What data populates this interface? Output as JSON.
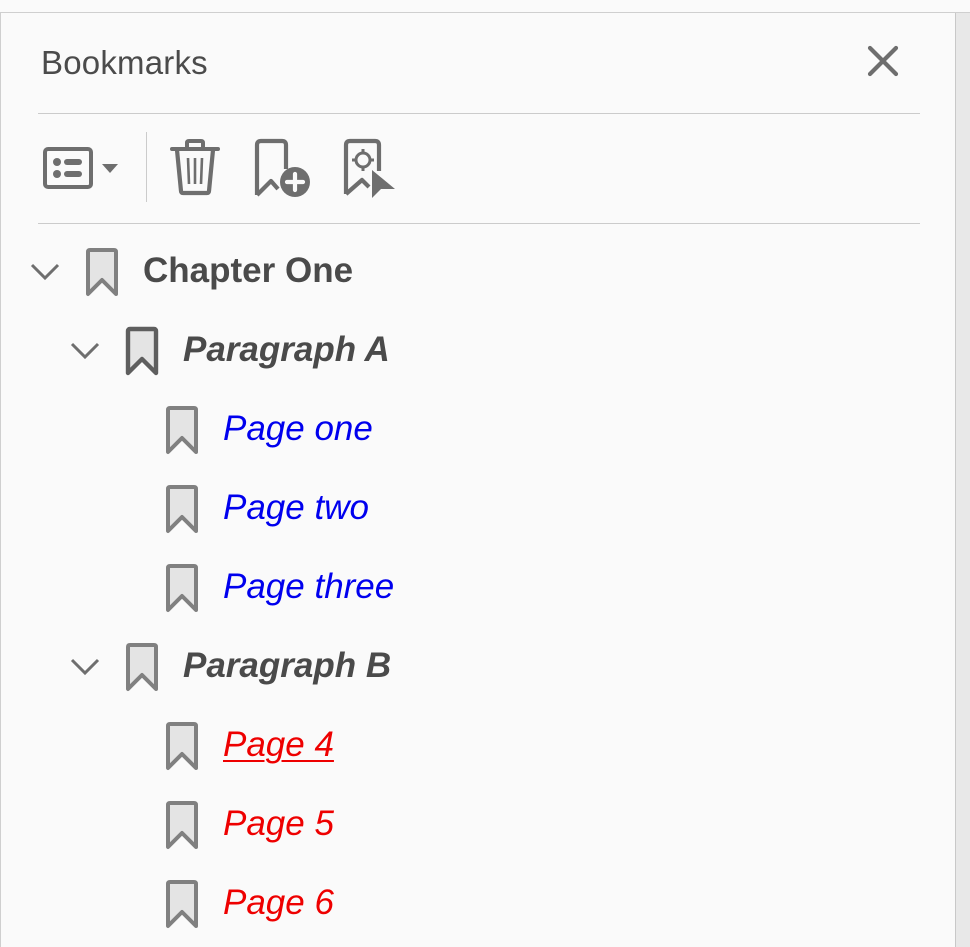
{
  "panel": {
    "title": "Bookmarks",
    "close_icon": "close-icon"
  },
  "toolbar": {
    "options_icon": "list-options-icon",
    "options_dropdown_icon": "caret-down-icon",
    "delete_icon": "trash-icon",
    "new_bookmark_icon": "bookmark-add-icon",
    "expand_current_icon": "bookmark-target-icon"
  },
  "colors": {
    "icon_gray": "#6e6e6e",
    "bookmark_stroke": "#808080",
    "bookmark_stroke_active": "#5e5e5e",
    "bookmark_fill": "#e4e4e4",
    "text_dark": "#4a4a4a",
    "link_blue": "#0000ee",
    "link_red": "#ee0000"
  },
  "tree": [
    {
      "label": "Chapter One",
      "level": 0,
      "expanded": true,
      "color": "#4a4a4a",
      "underlined": false,
      "active": false
    },
    {
      "label": "Paragraph A",
      "level": 1,
      "expanded": true,
      "color": "#4a4a4a",
      "underlined": false,
      "active": true
    },
    {
      "label": "Page one",
      "level": 2,
      "color": "#0000ee",
      "underlined": false,
      "active": false
    },
    {
      "label": "Page two",
      "level": 2,
      "color": "#0000ee",
      "underlined": false,
      "active": false
    },
    {
      "label": "Page three",
      "level": 2,
      "color": "#0000ee",
      "underlined": false,
      "active": false
    },
    {
      "label": "Paragraph B",
      "level": 1,
      "expanded": true,
      "color": "#4a4a4a",
      "underlined": false,
      "active": false
    },
    {
      "label": "Page 4",
      "level": 2,
      "color": "#ee0000",
      "underlined": true,
      "active": false
    },
    {
      "label": "Page 5",
      "level": 2,
      "color": "#ee0000",
      "underlined": false,
      "active": false
    },
    {
      "label": "Page 6",
      "level": 2,
      "color": "#ee0000",
      "underlined": false,
      "active": false
    }
  ]
}
